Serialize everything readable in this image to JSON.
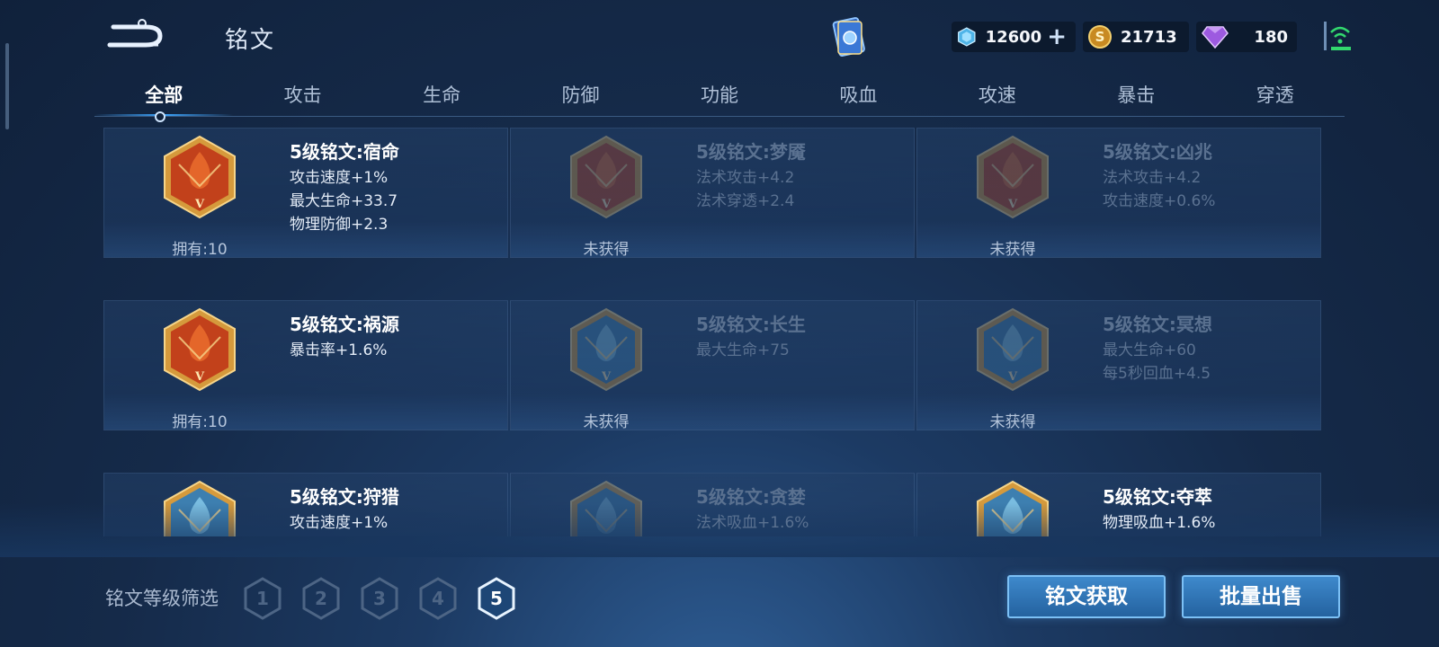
{
  "header": {
    "title": "铭文",
    "resources": [
      {
        "icon": "diamond-coupon-icon",
        "value": "12600"
      },
      {
        "icon": "gold-coin-icon",
        "value": "21713"
      },
      {
        "icon": "purple-gem-icon",
        "value": "180"
      }
    ],
    "plus_label": "+"
  },
  "tabs": [
    "全部",
    "攻击",
    "生命",
    "防御",
    "功能",
    "吸血",
    "攻速",
    "暴击",
    "穿透"
  ],
  "active_tab": 0,
  "cards": [
    {
      "name": "5级铭文:宿命",
      "stats": [
        "攻击速度+1%",
        "最大生命+33.7",
        "物理防御+2.3"
      ],
      "owned": "拥有:10",
      "locked": false,
      "color": "red"
    },
    {
      "name": "5级铭文:梦魇",
      "stats": [
        "法术攻击+4.2",
        "法术穿透+2.4"
      ],
      "owned": "未获得",
      "locked": true,
      "color": "red"
    },
    {
      "name": "5级铭文:凶兆",
      "stats": [
        "法术攻击+4.2",
        "攻击速度+0.6%"
      ],
      "owned": "未获得",
      "locked": true,
      "color": "red"
    },
    {
      "name": "5级铭文:祸源",
      "stats": [
        "暴击率+1.6%"
      ],
      "owned": "拥有:10",
      "locked": false,
      "color": "red"
    },
    {
      "name": "5级铭文:长生",
      "stats": [
        "最大生命+75"
      ],
      "owned": "未获得",
      "locked": true,
      "color": "blue"
    },
    {
      "name": "5级铭文:冥想",
      "stats": [
        "最大生命+60",
        "每5秒回血+4.5"
      ],
      "owned": "未获得",
      "locked": true,
      "color": "blue"
    },
    {
      "name": "5级铭文:狩猎",
      "stats": [
        "攻击速度+1%"
      ],
      "owned": "",
      "locked": false,
      "color": "blue"
    },
    {
      "name": "5级铭文:贪婪",
      "stats": [
        "法术吸血+1.6%"
      ],
      "owned": "",
      "locked": true,
      "color": "blue"
    },
    {
      "name": "5级铭文:夺萃",
      "stats": [
        "物理吸血+1.6%"
      ],
      "owned": "",
      "locked": false,
      "color": "blue"
    }
  ],
  "filter": {
    "label": "铭文等级筛选",
    "levels": [
      "1",
      "2",
      "3",
      "4",
      "5"
    ],
    "selected": "5"
  },
  "buttons": {
    "acquire": "铭文获取",
    "bulk_sell": "批量出售"
  },
  "colors": {
    "background": "#152a49",
    "accent": "#3ea6ff",
    "red_gem": "#c2411b",
    "blue_gem": "#3d7fb0",
    "gold_frame": "#d59a3c"
  }
}
